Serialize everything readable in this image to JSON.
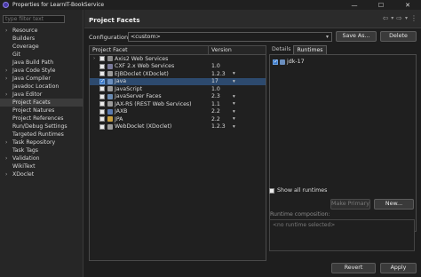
{
  "window": {
    "title": "Properties for LearnIT-BookService",
    "minimize": "—",
    "maximize": "☐",
    "close": "✕"
  },
  "sidebar": {
    "filter_placeholder": "type filter text",
    "items": [
      {
        "label": "Resource",
        "expandable": true
      },
      {
        "label": "Builders",
        "expandable": false
      },
      {
        "label": "Coverage",
        "expandable": false
      },
      {
        "label": "Git",
        "expandable": false
      },
      {
        "label": "Java Build Path",
        "expandable": false
      },
      {
        "label": "Java Code Style",
        "expandable": true
      },
      {
        "label": "Java Compiler",
        "expandable": true
      },
      {
        "label": "Javadoc Location",
        "expandable": false
      },
      {
        "label": "Java Editor",
        "expandable": true
      },
      {
        "label": "Project Facets",
        "expandable": false,
        "selected": true
      },
      {
        "label": "Project Natures",
        "expandable": false
      },
      {
        "label": "Project References",
        "expandable": false
      },
      {
        "label": "Run/Debug Settings",
        "expandable": false
      },
      {
        "label": "Targeted Runtimes",
        "expandable": false
      },
      {
        "label": "Task Repository",
        "expandable": true
      },
      {
        "label": "Task Tags",
        "expandable": false
      },
      {
        "label": "Validation",
        "expandable": true
      },
      {
        "label": "WikiText",
        "expandable": false
      },
      {
        "label": "XDoclet",
        "expandable": true
      }
    ]
  },
  "header": {
    "title": "Project Facets",
    "back": "⇦",
    "back_menu": "▾",
    "forward": "⇨",
    "forward_menu": "▾",
    "more": "⋮"
  },
  "configuration": {
    "label": "Configuration:",
    "value": "<custom>",
    "save_as_label": "Save As...",
    "delete_label": "Delete"
  },
  "facets": {
    "col_facet": "Project Facet",
    "col_version": "Version",
    "rows": [
      {
        "name": "Axis2 Web Services",
        "version": "",
        "expandable": true,
        "checked": false,
        "dropdown": false,
        "icon_color": "#8a8a8a"
      },
      {
        "name": "CXF 2.x Web Services",
        "version": "1.0",
        "expandable": false,
        "checked": false,
        "dropdown": false,
        "icon_color": "#7a7a9a"
      },
      {
        "name": "EJBDoclet (XDoclet)",
        "version": "1.2.3",
        "expandable": false,
        "checked": false,
        "dropdown": true,
        "icon_color": "#9a9a9a"
      },
      {
        "name": "Java",
        "version": "17",
        "expandable": false,
        "checked": true,
        "dropdown": true,
        "icon_color": "#6b8fbf",
        "selected": true
      },
      {
        "name": "JavaScript",
        "version": "1.0",
        "expandable": false,
        "checked": false,
        "dropdown": false,
        "icon_color": "#9a9a9a"
      },
      {
        "name": "JavaServer Faces",
        "version": "2.3",
        "expandable": false,
        "checked": false,
        "dropdown": true,
        "icon_color": "#6a8ab0"
      },
      {
        "name": "JAX-RS (REST Web Services)",
        "version": "1.1",
        "expandable": false,
        "checked": false,
        "dropdown": true,
        "icon_color": "#9a9a9a"
      },
      {
        "name": "JAXB",
        "version": "2.2",
        "expandable": false,
        "checked": false,
        "dropdown": true,
        "icon_color": "#5a7ab0"
      },
      {
        "name": "JPA",
        "version": "2.2",
        "expandable": false,
        "checked": false,
        "dropdown": true,
        "icon_color": "#c9a040"
      },
      {
        "name": "WebDoclet (XDoclet)",
        "version": "1.2.3",
        "expandable": false,
        "checked": false,
        "dropdown": true,
        "icon_color": "#9a9a9a"
      }
    ]
  },
  "details": {
    "tab_details": "Details",
    "tab_runtimes": "Runtimes",
    "runtime_name": "jdk-17",
    "runtime_checked": true,
    "show_all_label": "Show all runtimes",
    "make_primary_label": "Make Primary",
    "new_label": "New...",
    "composition_label": "Runtime composition:",
    "composition_placeholder": "<no runtime selected>"
  },
  "footer": {
    "revert_label": "Revert",
    "apply_label": "Apply"
  }
}
